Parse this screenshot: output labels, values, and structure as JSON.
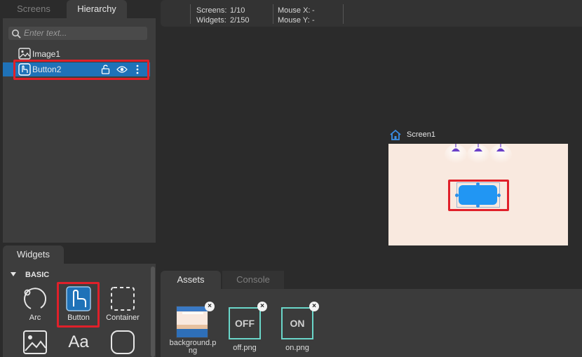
{
  "hierarchy_panel": {
    "tabs": [
      {
        "label": "Screens",
        "active": false
      },
      {
        "label": "Hierarchy",
        "active": true
      }
    ],
    "search_placeholder": "Enter text...",
    "tree": [
      {
        "label": "Image1",
        "icon": "image-icon",
        "selected": false
      },
      {
        "label": "Button2",
        "icon": "button-widget-icon",
        "selected": true
      }
    ]
  },
  "status_bar": {
    "screens_label": "Screens:",
    "screens_value": "1/10",
    "widgets_label": "Widgets:",
    "widgets_value": "2/150",
    "mouse_x_label": "Mouse X:",
    "mouse_x_value": "-",
    "mouse_y_label": "Mouse Y:",
    "mouse_y_value": "-"
  },
  "canvas": {
    "screen_name": "Screen1",
    "screen_bg": "#f9e9df",
    "button_color": "#2196f3",
    "lamp_color": "#6a40c8"
  },
  "widgets_panel": {
    "tab_label": "Widgets",
    "category": "BASIC",
    "items": [
      {
        "label": "Arc",
        "icon": "arc-icon"
      },
      {
        "label": "Button",
        "icon": "button-widget-icon"
      },
      {
        "label": "Container",
        "icon": "container-icon"
      },
      {
        "label": "",
        "icon": "image-icon"
      },
      {
        "label": "",
        "icon": "label-icon",
        "glyph": "Aa"
      },
      {
        "label": "",
        "icon": "rounded-panel-icon"
      }
    ]
  },
  "assets_panel": {
    "tabs": [
      {
        "label": "Assets",
        "active": true
      },
      {
        "label": "Console",
        "active": false
      }
    ],
    "assets": [
      {
        "name": "background.png",
        "name_line1": "background.p",
        "name_line2": "ng"
      },
      {
        "name": "off.png",
        "thumb_text": "OFF"
      },
      {
        "name": "on.png",
        "thumb_text": "ON"
      }
    ],
    "close_glyph": "×"
  },
  "colors": {
    "highlight": "#e0202a",
    "selection": "#1f72b8",
    "asset_border": "#6ad6c9"
  }
}
